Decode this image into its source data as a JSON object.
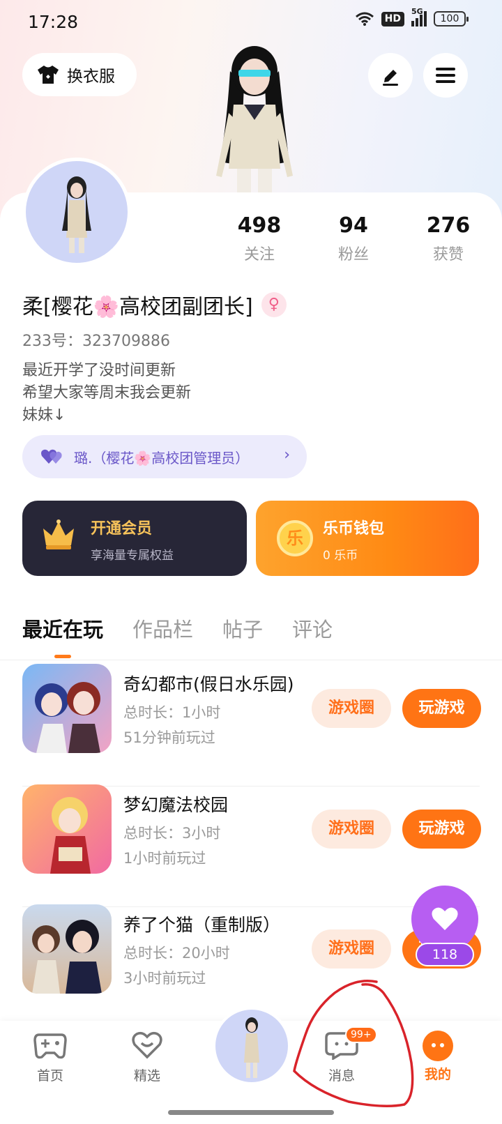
{
  "status_bar": {
    "time": "17:28",
    "network_hd": "HD",
    "network_type": "5G",
    "battery": "100"
  },
  "header": {
    "outfit_button_label": "换衣服"
  },
  "profile": {
    "stats": [
      {
        "value": "498",
        "label": "关注"
      },
      {
        "value": "94",
        "label": "粉丝"
      },
      {
        "value": "276",
        "label": "获赞"
      }
    ],
    "username": "柔[樱花🌸高校团副团长]",
    "user_id": "233号：323709886",
    "bio_lines": [
      "最近开学了没时间更新",
      "希望大家等周末我会更新",
      "妹妹↓"
    ],
    "club_link": "璐.（樱花🌸高校团管理员）"
  },
  "promos": {
    "vip": {
      "title": "开通会员",
      "subtitle": "享海量专属权益"
    },
    "wallet": {
      "title": "乐币钱包",
      "subtitle": "0 乐币",
      "coin_glyph": "乐"
    }
  },
  "tabs": [
    {
      "label": "最近在玩",
      "active": true
    },
    {
      "label": "作品栏",
      "active": false
    },
    {
      "label": "帖子",
      "active": false
    },
    {
      "label": "评论",
      "active": false
    }
  ],
  "games": [
    {
      "name": "奇幻都市(假日水乐园)",
      "duration": "总时长：1小时",
      "last_played": "51分钟前玩过"
    },
    {
      "name": "梦幻魔法校园",
      "duration": "总时长：3小时",
      "last_played": "1小时前玩过"
    },
    {
      "name": "养了个猫（重制版）",
      "duration": "总时长：20小时",
      "last_played": "3小时前玩过"
    }
  ],
  "game_buttons": {
    "circle": "游戏圈",
    "play": "玩游戏"
  },
  "like_fab": {
    "count": "118"
  },
  "bottom_nav": {
    "items": [
      {
        "label": "首页",
        "icon": "gamepad-icon"
      },
      {
        "label": "精选",
        "icon": "heart-icon"
      },
      {
        "label": "消息",
        "icon": "chat-icon",
        "badge": "99+"
      },
      {
        "label": "我的",
        "icon": "face-icon",
        "active": true
      }
    ]
  },
  "colors": {
    "accent": "#ff7414",
    "purple": "#b75ef2",
    "dark_card": "#272637",
    "annotation": "#d9232a"
  }
}
